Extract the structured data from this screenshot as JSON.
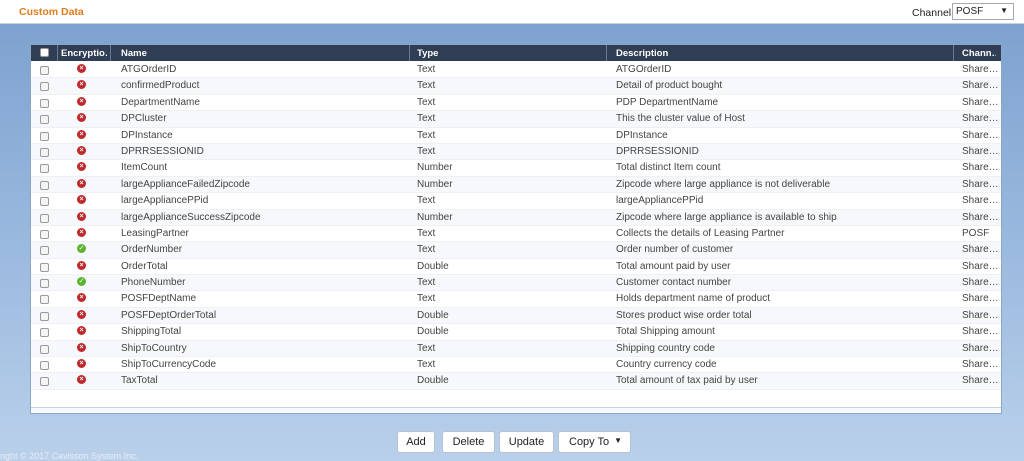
{
  "header": {
    "title": "Custom Data",
    "channel_label": "Channel",
    "channel_value": "POSF"
  },
  "table": {
    "columns": [
      "Encryptio…",
      "Name",
      "Type",
      "Description",
      "Chann…"
    ],
    "rows": [
      {
        "encrypted": false,
        "name": "ATGOrderID",
        "type": "Text",
        "description": "ATGOrderID",
        "channel": "Share…"
      },
      {
        "encrypted": false,
        "name": "confirmedProduct",
        "type": "Text",
        "description": "Detail of product bought",
        "channel": "Share…"
      },
      {
        "encrypted": false,
        "name": "DepartmentName",
        "type": "Text",
        "description": "PDP DepartmentName",
        "channel": "Share…"
      },
      {
        "encrypted": false,
        "name": "DPCluster",
        "type": "Text",
        "description": "This the cluster value of Host",
        "channel": "Share…"
      },
      {
        "encrypted": false,
        "name": "DPInstance",
        "type": "Text",
        "description": "DPInstance",
        "channel": "Share…"
      },
      {
        "encrypted": false,
        "name": "DPRRSESSIONID",
        "type": "Text",
        "description": "DPRRSESSIONID",
        "channel": "Share…"
      },
      {
        "encrypted": false,
        "name": "ItemCount",
        "type": "Number",
        "description": "Total distinct Item count",
        "channel": "Share…"
      },
      {
        "encrypted": false,
        "name": "largeApplianceFailedZipcode",
        "type": "Number",
        "description": "Zipcode where large appliance is not deliverable",
        "channel": "Share…"
      },
      {
        "encrypted": false,
        "name": "largeAppliancePPid",
        "type": "Text",
        "description": "largeAppliancePPid",
        "channel": "Share…"
      },
      {
        "encrypted": false,
        "name": "largeApplianceSuccessZipcode",
        "type": "Number",
        "description": "Zipcode where large appliance is available to ship",
        "channel": "Share…"
      },
      {
        "encrypted": false,
        "name": "LeasingPartner",
        "type": "Text",
        "description": "Collects the details of Leasing Partner",
        "channel": "POSF"
      },
      {
        "encrypted": true,
        "name": "OrderNumber",
        "type": "Text",
        "description": "Order number of customer",
        "channel": "Share…"
      },
      {
        "encrypted": false,
        "name": "OrderTotal",
        "type": "Double",
        "description": "Total amount paid by user",
        "channel": "Share…"
      },
      {
        "encrypted": true,
        "name": "PhoneNumber",
        "type": "Text",
        "description": "Customer contact number",
        "channel": "Share…"
      },
      {
        "encrypted": false,
        "name": "POSFDeptName",
        "type": "Text",
        "description": "Holds department name of product",
        "channel": "Share…"
      },
      {
        "encrypted": false,
        "name": "POSFDeptOrderTotal",
        "type": "Double",
        "description": "Stores product wise order total",
        "channel": "Share…"
      },
      {
        "encrypted": false,
        "name": "ShippingTotal",
        "type": "Double",
        "description": "Total Shipping amount",
        "channel": "Share…"
      },
      {
        "encrypted": false,
        "name": "ShipToCountry",
        "type": "Text",
        "description": "Shipping country code",
        "channel": "Share…"
      },
      {
        "encrypted": false,
        "name": "ShipToCurrencyCode",
        "type": "Text",
        "description": "Country currency code",
        "channel": "Share…"
      },
      {
        "encrypted": false,
        "name": "TaxTotal",
        "type": "Double",
        "description": "Total amount of tax paid by user",
        "channel": "Share…"
      }
    ]
  },
  "buttons": {
    "add": "Add",
    "delete": "Delete",
    "update": "Update",
    "copy_to": "Copy To"
  },
  "footer": {
    "copyright": "right © 2017  Cavisson System Inc."
  },
  "colors": {
    "title": "#e07b1d",
    "header_bg": "#2f3e55",
    "encrypted_no": "#c0292b",
    "encrypted_yes": "#5cb531"
  }
}
